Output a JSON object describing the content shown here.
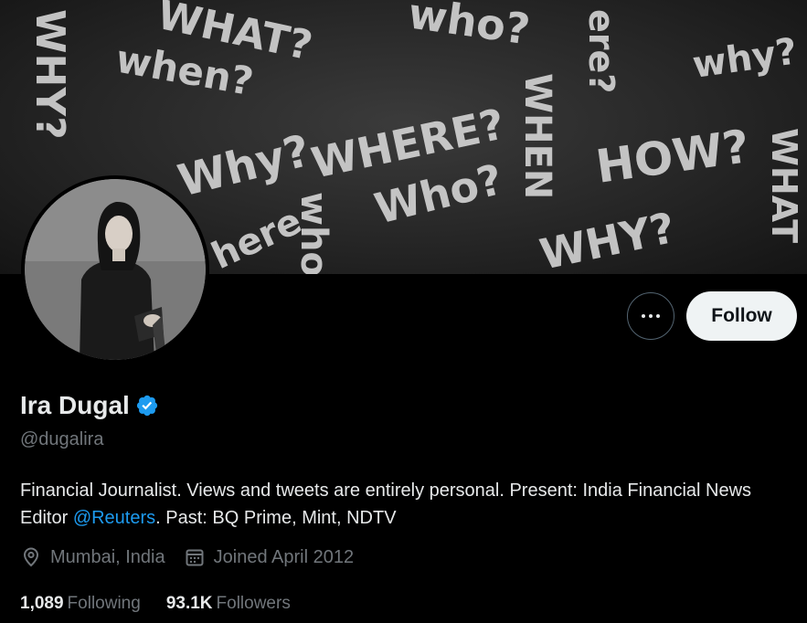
{
  "profile": {
    "name": "Ira Dugal",
    "handle": "@dugalira",
    "bio_part1": "Financial Journalist. Views and tweets are entirely personal. Present: India Financial News Editor ",
    "bio_mention": "@Reuters",
    "bio_part2": ". Past: BQ Prime, Mint, NDTV",
    "location": "Mumbai, India",
    "joined": "Joined April 2012",
    "following_count": "1,089",
    "following_label": "Following",
    "followers_count": "93.1K",
    "followers_label": "Followers"
  },
  "actions": {
    "follow_label": "Follow",
    "more_icon": "more-horizontal-icon"
  },
  "banner": {
    "words": [
      "WHY?",
      "WHAT?",
      "who?",
      "when?",
      "why?",
      "WHERE?",
      "WHEN",
      "HOW?",
      "Who?",
      "WHY?",
      "here",
      "who",
      "WHAT",
      "Why?",
      "ere?"
    ]
  },
  "colors": {
    "accent": "#1d9bf0",
    "background": "#000000",
    "text_primary": "#e7e9ea",
    "text_secondary": "#71767b",
    "follow_bg": "#eff3f4"
  }
}
